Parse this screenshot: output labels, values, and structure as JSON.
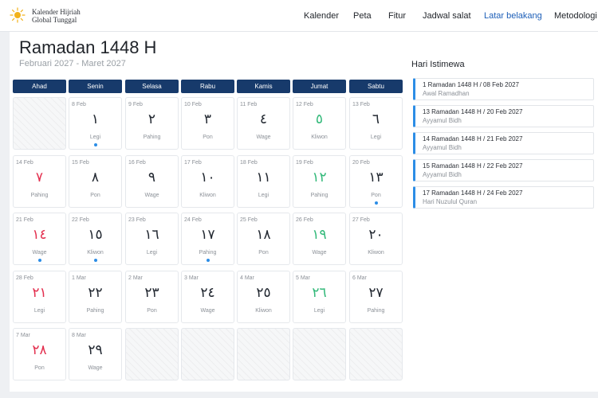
{
  "header": {
    "brand_line1": "Kalender Hijriah",
    "brand_line2": "Global Tunggal",
    "nav": [
      "Kalender",
      "Peta",
      "Fitur",
      "Jadwal salat",
      "Latar belakang",
      "Metodologi"
    ],
    "active_nav": "Latar belakang",
    "accent": "#1d5fb8"
  },
  "calendar": {
    "title": "Ramadan 1448 H",
    "subtitle": "Februari 2027 - Maret 2027",
    "weekdays": [
      "Ahad",
      "Senin",
      "Selasa",
      "Rabu",
      "Kamis",
      "Jumat",
      "Sabtu"
    ],
    "colors": {
      "header": "#173a6b",
      "friday": "#33b97a",
      "sunday": "#e3304f",
      "dot": "#2c8de6"
    },
    "weeks": [
      [
        null,
        {
          "greg": "8 Feb",
          "hijri": "١",
          "pasaran": "Legi",
          "dot": true
        },
        {
          "greg": "9 Feb",
          "hijri": "٢",
          "pasaran": "Pahing"
        },
        {
          "greg": "10 Feb",
          "hijri": "٣",
          "pasaran": "Pon"
        },
        {
          "greg": "11 Feb",
          "hijri": "٤",
          "pasaran": "Wage"
        },
        {
          "greg": "12 Feb",
          "hijri": "٥",
          "pasaran": "Kliwon"
        },
        {
          "greg": "13 Feb",
          "hijri": "٦",
          "pasaran": "Legi"
        }
      ],
      [
        {
          "greg": "14 Feb",
          "hijri": "٧",
          "pasaran": "Pahing"
        },
        {
          "greg": "15 Feb",
          "hijri": "٨",
          "pasaran": "Pon"
        },
        {
          "greg": "16 Feb",
          "hijri": "٩",
          "pasaran": "Wage"
        },
        {
          "greg": "17 Feb",
          "hijri": "١٠",
          "pasaran": "Kliwon"
        },
        {
          "greg": "18 Feb",
          "hijri": "١١",
          "pasaran": "Legi"
        },
        {
          "greg": "19 Feb",
          "hijri": "١٢",
          "pasaran": "Pahing"
        },
        {
          "greg": "20 Feb",
          "hijri": "١٣",
          "pasaran": "Pon",
          "dot": true
        }
      ],
      [
        {
          "greg": "21 Feb",
          "hijri": "١٤",
          "pasaran": "Wage",
          "dot": true
        },
        {
          "greg": "22 Feb",
          "hijri": "١٥",
          "pasaran": "Kliwon",
          "dot": true
        },
        {
          "greg": "23 Feb",
          "hijri": "١٦",
          "pasaran": "Legi"
        },
        {
          "greg": "24 Feb",
          "hijri": "١٧",
          "pasaran": "Pahing",
          "dot": true
        },
        {
          "greg": "25 Feb",
          "hijri": "١٨",
          "pasaran": "Pon"
        },
        {
          "greg": "26 Feb",
          "hijri": "١٩",
          "pasaran": "Wage"
        },
        {
          "greg": "27 Feb",
          "hijri": "٢٠",
          "pasaran": "Kliwon"
        }
      ],
      [
        {
          "greg": "28 Feb",
          "hijri": "٢١",
          "pasaran": "Legi"
        },
        {
          "greg": "1 Mar",
          "hijri": "٢٢",
          "pasaran": "Pahing"
        },
        {
          "greg": "2 Mar",
          "hijri": "٢٣",
          "pasaran": "Pon"
        },
        {
          "greg": "3 Mar",
          "hijri": "٢٤",
          "pasaran": "Wage"
        },
        {
          "greg": "4 Mar",
          "hijri": "٢٥",
          "pasaran": "Kliwon"
        },
        {
          "greg": "5 Mar",
          "hijri": "٢٦",
          "pasaran": "Legi"
        },
        {
          "greg": "6 Mar",
          "hijri": "٢٧",
          "pasaran": "Pahing"
        }
      ],
      [
        {
          "greg": "7 Mar",
          "hijri": "٢٨",
          "pasaran": "Pon"
        },
        {
          "greg": "8 Mar",
          "hijri": "٢٩",
          "pasaran": "Wage"
        },
        null,
        null,
        null,
        null,
        null
      ]
    ]
  },
  "events": {
    "title": "Hari Istimewa",
    "items": [
      {
        "date": "1 Ramadan 1448 H / 08 Feb 2027",
        "name": "Awal Ramadhan"
      },
      {
        "date": "13 Ramadan 1448 H / 20 Feb 2027",
        "name": "Ayyamul Bidh"
      },
      {
        "date": "14 Ramadan 1448 H / 21 Feb 2027",
        "name": "Ayyamul Bidh"
      },
      {
        "date": "15 Ramadan 1448 H / 22 Feb 2027",
        "name": "Ayyamul Bidh"
      },
      {
        "date": "17 Ramadan 1448 H / 24 Feb 2027",
        "name": "Hari Nuzulul Quran"
      }
    ]
  }
}
